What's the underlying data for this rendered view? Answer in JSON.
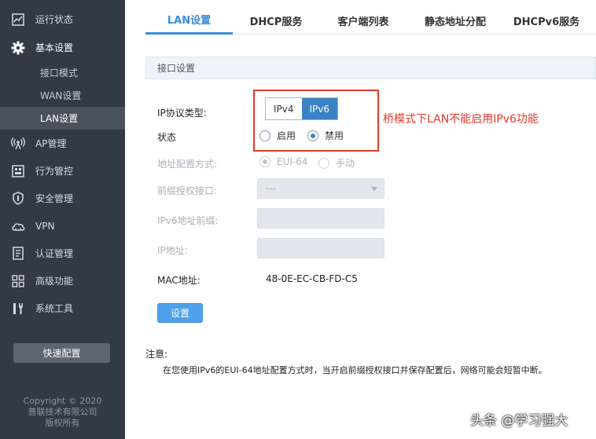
{
  "sidebar": {
    "items": [
      {
        "label": "运行状态",
        "icon": "chart-icon"
      },
      {
        "label": "基本设置",
        "icon": "gear-icon"
      },
      {
        "label": "AP管理",
        "icon": "ap-signal-icon"
      },
      {
        "label": "行为管控",
        "icon": "behavior-control-icon"
      },
      {
        "label": "安全管理",
        "icon": "shield-icon"
      },
      {
        "label": "VPN",
        "icon": "cloud-icon"
      },
      {
        "label": "认证管理",
        "icon": "auth-document-icon"
      },
      {
        "label": "高级功能",
        "icon": "grid-icon"
      },
      {
        "label": "系统工具",
        "icon": "tools-icon"
      }
    ],
    "sub_items": [
      {
        "label": "接口模式"
      },
      {
        "label": "WAN设置"
      },
      {
        "label": "LAN设置"
      }
    ],
    "quick_config": "快速配置",
    "copyright": [
      "Copyright © 2020",
      "普联技术有限公司",
      "版权所有"
    ]
  },
  "tabs": [
    "LAN设置",
    "DHCP服务",
    "客户端列表",
    "静态地址分配",
    "DHCPv6服务"
  ],
  "panel": {
    "title": "接口设置",
    "ip_protocol_label": "IP协议类型:",
    "ip_protocol_options": [
      "IPv4",
      "IPv6"
    ],
    "ip_protocol_selected": "IPv6",
    "status_label": "状态",
    "status_options": [
      "启用",
      "禁用"
    ],
    "status_selected": "禁用",
    "addr_mode_label": "地址配置方式:",
    "addr_mode_options": [
      "EUI-64",
      "手动"
    ],
    "prefix_iface_label": "前缀授权接口:",
    "prefix_iface_value": "---",
    "ipv6_prefix_label": "IPv6地址前缀:",
    "ip_addr_label": "IP地址:",
    "mac_label": "MAC地址:",
    "mac_value": "48-0E-EC-CB-FD-C5",
    "set_button": "设置"
  },
  "annotation": "桥模式下LAN不能启用IPv6功能",
  "note": {
    "title": "注意:",
    "text": "在您使用IPv6的EUI-64地址配置方式时，当开启前缀授权接口并保存配置后，网络可能会短暂中断。"
  },
  "watermark": "头条 @学习强大",
  "colors": {
    "sidebar_bg": "#323a46",
    "accent": "#3a82c4",
    "annotation_red": "#e23a2a"
  }
}
